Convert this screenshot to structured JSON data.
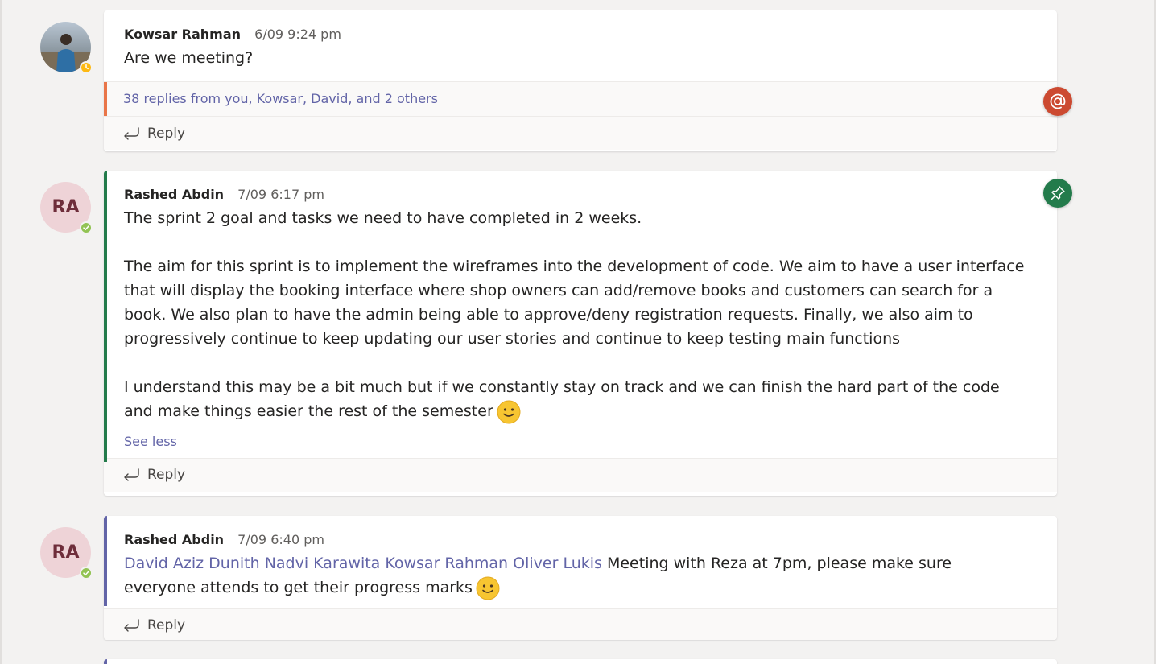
{
  "messages": [
    {
      "author": "Kowsar Rahman",
      "timestamp": "6/09 9:24 pm",
      "avatar": {
        "type": "photo",
        "presence": "away"
      },
      "body": "Are we meeting?",
      "replies_summary": "38 replies from you, Kowsar, David, and 2 others",
      "reply_label": "Reply",
      "badge": "mention-icon"
    },
    {
      "author": "Rashed Abdin",
      "timestamp": "7/09 6:17 pm",
      "avatar": {
        "initials": "RA",
        "presence": "available"
      },
      "paragraphs": [
        "The sprint 2 goal and tasks we need to have completed in 2 weeks.",
        "The aim for this sprint is to implement the wireframes into the development of code. We aim to have a user interface that will display the booking interface where shop owners can add/remove books and customers can search for a book. We also plan to have the admin being able to approve/deny registration requests. Finally, we also aim to progressively continue to keep updating our user stories and continue to keep testing main functions",
        "I understand this may be a bit much but if we constantly stay on track and we can finish the hard part of the code and make things easier the rest of the semester"
      ],
      "see_less": "See less",
      "reply_label": "Reply",
      "badge": "pin-icon"
    },
    {
      "author": "Rashed Abdin",
      "timestamp": "7/09 6:40 pm",
      "avatar": {
        "initials": "RA",
        "presence": "available"
      },
      "mentions": [
        "David Aziz",
        "Dunith Nadvi Karawita",
        "Kowsar Rahman",
        "Oliver Lukis"
      ],
      "body": "Meeting with Reza at 7pm, please make sure everyone attends to get their progress marks",
      "reply_label": "Reply"
    }
  ],
  "colors": {
    "accent": "#6264a7",
    "mention_badge": "#cc4a31",
    "pin_badge": "#237b4b",
    "important_bar": "#237b4b",
    "announcement_bar": "#6264a7",
    "unread_mention_bar": "#e97548"
  }
}
